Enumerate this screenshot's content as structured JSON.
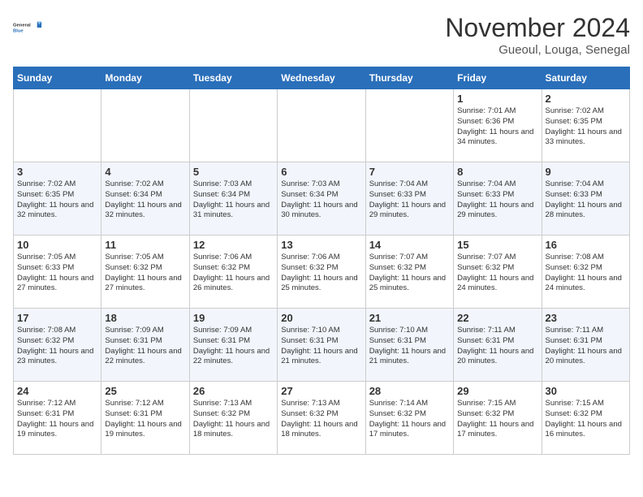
{
  "logo": {
    "general": "General",
    "blue": "Blue"
  },
  "title": "November 2024",
  "subtitle": "Gueoul, Louga, Senegal",
  "weekdays": [
    "Sunday",
    "Monday",
    "Tuesday",
    "Wednesday",
    "Thursday",
    "Friday",
    "Saturday"
  ],
  "weeks": [
    [
      {
        "day": "",
        "info": ""
      },
      {
        "day": "",
        "info": ""
      },
      {
        "day": "",
        "info": ""
      },
      {
        "day": "",
        "info": ""
      },
      {
        "day": "",
        "info": ""
      },
      {
        "day": "1",
        "info": "Sunrise: 7:01 AM\nSunset: 6:36 PM\nDaylight: 11 hours and 34 minutes."
      },
      {
        "day": "2",
        "info": "Sunrise: 7:02 AM\nSunset: 6:35 PM\nDaylight: 11 hours and 33 minutes."
      }
    ],
    [
      {
        "day": "3",
        "info": "Sunrise: 7:02 AM\nSunset: 6:35 PM\nDaylight: 11 hours and 32 minutes."
      },
      {
        "day": "4",
        "info": "Sunrise: 7:02 AM\nSunset: 6:34 PM\nDaylight: 11 hours and 32 minutes."
      },
      {
        "day": "5",
        "info": "Sunrise: 7:03 AM\nSunset: 6:34 PM\nDaylight: 11 hours and 31 minutes."
      },
      {
        "day": "6",
        "info": "Sunrise: 7:03 AM\nSunset: 6:34 PM\nDaylight: 11 hours and 30 minutes."
      },
      {
        "day": "7",
        "info": "Sunrise: 7:04 AM\nSunset: 6:33 PM\nDaylight: 11 hours and 29 minutes."
      },
      {
        "day": "8",
        "info": "Sunrise: 7:04 AM\nSunset: 6:33 PM\nDaylight: 11 hours and 29 minutes."
      },
      {
        "day": "9",
        "info": "Sunrise: 7:04 AM\nSunset: 6:33 PM\nDaylight: 11 hours and 28 minutes."
      }
    ],
    [
      {
        "day": "10",
        "info": "Sunrise: 7:05 AM\nSunset: 6:33 PM\nDaylight: 11 hours and 27 minutes."
      },
      {
        "day": "11",
        "info": "Sunrise: 7:05 AM\nSunset: 6:32 PM\nDaylight: 11 hours and 27 minutes."
      },
      {
        "day": "12",
        "info": "Sunrise: 7:06 AM\nSunset: 6:32 PM\nDaylight: 11 hours and 26 minutes."
      },
      {
        "day": "13",
        "info": "Sunrise: 7:06 AM\nSunset: 6:32 PM\nDaylight: 11 hours and 25 minutes."
      },
      {
        "day": "14",
        "info": "Sunrise: 7:07 AM\nSunset: 6:32 PM\nDaylight: 11 hours and 25 minutes."
      },
      {
        "day": "15",
        "info": "Sunrise: 7:07 AM\nSunset: 6:32 PM\nDaylight: 11 hours and 24 minutes."
      },
      {
        "day": "16",
        "info": "Sunrise: 7:08 AM\nSunset: 6:32 PM\nDaylight: 11 hours and 24 minutes."
      }
    ],
    [
      {
        "day": "17",
        "info": "Sunrise: 7:08 AM\nSunset: 6:32 PM\nDaylight: 11 hours and 23 minutes."
      },
      {
        "day": "18",
        "info": "Sunrise: 7:09 AM\nSunset: 6:31 PM\nDaylight: 11 hours and 22 minutes."
      },
      {
        "day": "19",
        "info": "Sunrise: 7:09 AM\nSunset: 6:31 PM\nDaylight: 11 hours and 22 minutes."
      },
      {
        "day": "20",
        "info": "Sunrise: 7:10 AM\nSunset: 6:31 PM\nDaylight: 11 hours and 21 minutes."
      },
      {
        "day": "21",
        "info": "Sunrise: 7:10 AM\nSunset: 6:31 PM\nDaylight: 11 hours and 21 minutes."
      },
      {
        "day": "22",
        "info": "Sunrise: 7:11 AM\nSunset: 6:31 PM\nDaylight: 11 hours and 20 minutes."
      },
      {
        "day": "23",
        "info": "Sunrise: 7:11 AM\nSunset: 6:31 PM\nDaylight: 11 hours and 20 minutes."
      }
    ],
    [
      {
        "day": "24",
        "info": "Sunrise: 7:12 AM\nSunset: 6:31 PM\nDaylight: 11 hours and 19 minutes."
      },
      {
        "day": "25",
        "info": "Sunrise: 7:12 AM\nSunset: 6:31 PM\nDaylight: 11 hours and 19 minutes."
      },
      {
        "day": "26",
        "info": "Sunrise: 7:13 AM\nSunset: 6:32 PM\nDaylight: 11 hours and 18 minutes."
      },
      {
        "day": "27",
        "info": "Sunrise: 7:13 AM\nSunset: 6:32 PM\nDaylight: 11 hours and 18 minutes."
      },
      {
        "day": "28",
        "info": "Sunrise: 7:14 AM\nSunset: 6:32 PM\nDaylight: 11 hours and 17 minutes."
      },
      {
        "day": "29",
        "info": "Sunrise: 7:15 AM\nSunset: 6:32 PM\nDaylight: 11 hours and 17 minutes."
      },
      {
        "day": "30",
        "info": "Sunrise: 7:15 AM\nSunset: 6:32 PM\nDaylight: 11 hours and 16 minutes."
      }
    ]
  ]
}
